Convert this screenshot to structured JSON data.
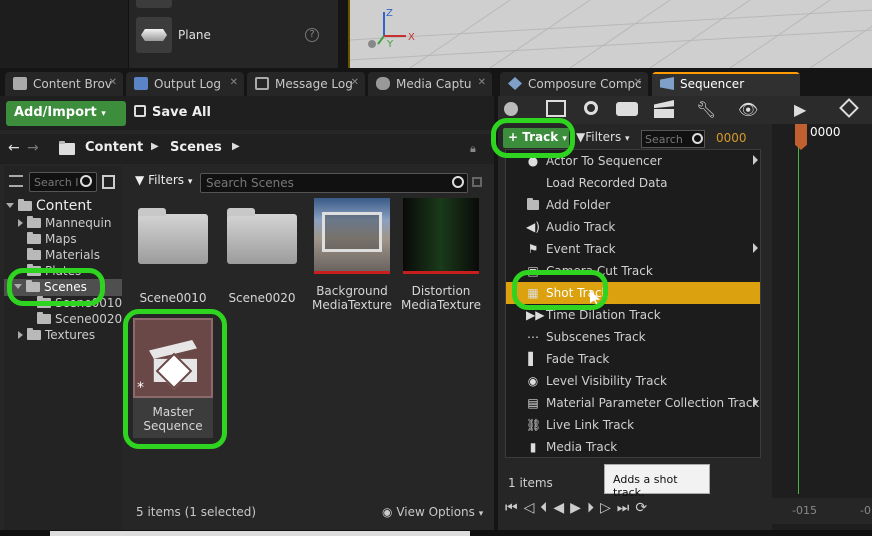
{
  "details": {
    "item_label": "Plane",
    "help_icon": "question-icon"
  },
  "viewport": {
    "axis_z": "Z",
    "axis_x": "X",
    "axis_y": "Y"
  },
  "tabs": [
    {
      "label": "Content Brov",
      "icon": "folder-icon"
    },
    {
      "label": "Output Log",
      "icon": "log-icon"
    },
    {
      "label": "Message Log",
      "icon": "message-icon"
    },
    {
      "label": "Media Captu",
      "icon": "camera-icon"
    },
    {
      "label": "Composure Compc",
      "icon": "composure-icon"
    },
    {
      "label": "Sequencer",
      "icon": "sequencer-icon"
    }
  ],
  "content_browser": {
    "add_import_label": "Add/Import",
    "save_all_label": "Save All",
    "breadcrumb": [
      "Content",
      "Scenes"
    ],
    "tree_search_placeholder": "Search I",
    "tree": [
      {
        "label": "Content",
        "level": 0,
        "expanded": true
      },
      {
        "label": "Mannequin",
        "level": 1
      },
      {
        "label": "Maps",
        "level": 1
      },
      {
        "label": "Materials",
        "level": 1
      },
      {
        "label": "Plates",
        "level": 1
      },
      {
        "label": "Scenes",
        "level": 1,
        "expanded": true,
        "selected": true
      },
      {
        "label": "Scene0010",
        "level": 2
      },
      {
        "label": "Scene0020",
        "level": 2
      },
      {
        "label": "Textures",
        "level": 1
      }
    ],
    "filters_label": "Filters",
    "search_placeholder": "Search Scenes",
    "assets": [
      {
        "label": "Scene0010",
        "kind": "folder"
      },
      {
        "label": "Scene0020",
        "kind": "folder"
      },
      {
        "label": "Background MediaTexture",
        "kind": "texture-photo"
      },
      {
        "label": "Distortion MediaTexture",
        "kind": "texture-dark"
      },
      {
        "label": "Master Sequence",
        "kind": "level-sequence",
        "selected": true
      }
    ],
    "status": "5 items (1 selected)",
    "view_options_label": "View Options"
  },
  "sequencer": {
    "track_label": "Track",
    "filters_label": "Filters",
    "search_placeholder": "Search",
    "timecode": "0000",
    "playhead_time": "0000",
    "menu": [
      {
        "label": "Actor To Sequencer",
        "icon": "actor-icon",
        "submenu": true
      },
      {
        "label": "Load Recorded Data",
        "icon": "load-icon",
        "submenu": false
      },
      {
        "label": "Add Folder",
        "icon": "folder-icon",
        "submenu": false
      },
      {
        "label": "Audio Track",
        "icon": "audio-icon",
        "submenu": false
      },
      {
        "label": "Event Track",
        "icon": "event-flag-icon",
        "submenu": true
      },
      {
        "label": "Camera Cut Track",
        "icon": "camera-cut-icon",
        "submenu": false
      },
      {
        "label": "Shot Track",
        "icon": "shot-track-icon",
        "submenu": false,
        "highlighted": true
      },
      {
        "label": "Time Dilation Track",
        "icon": "time-dilation-icon",
        "submenu": false
      },
      {
        "label": "Subscenes Track",
        "icon": "subscenes-icon",
        "submenu": false
      },
      {
        "label": "Fade Track",
        "icon": "fade-icon",
        "submenu": false
      },
      {
        "label": "Level Visibility Track",
        "icon": "eye-icon",
        "submenu": false
      },
      {
        "label": "Material Parameter Collection Track",
        "icon": "material-icon",
        "submenu": true
      },
      {
        "label": "Live Link Track",
        "icon": "live-link-icon",
        "submenu": false
      },
      {
        "label": "Media Track",
        "icon": "media-icon",
        "submenu": false
      }
    ],
    "tooltip": "Adds a shot track.",
    "item_count": "1 items",
    "ruler_labels": [
      "-015",
      "-0"
    ]
  },
  "colors": {
    "accent_green": "#3c8d3c",
    "highlight": "#dba10e",
    "annotation_ring": "#2ed41f",
    "timecode": "#d6992a"
  }
}
